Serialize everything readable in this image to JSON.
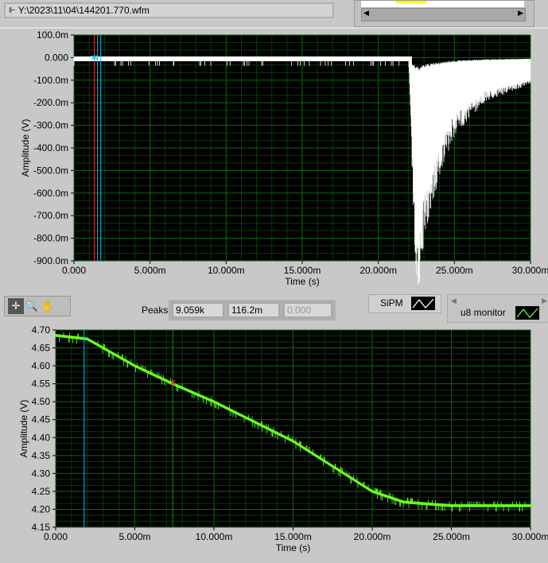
{
  "file_path": {
    "icon": "path-icon",
    "value": "Y:\\2023\\11\\04\\144201.770.wfm"
  },
  "toolbar": {
    "tools": [
      "cursor-move-icon",
      "zoom-icon",
      "pan-hand-icon"
    ]
  },
  "peaks": {
    "label": "Peaks",
    "values": [
      "9.059k",
      "116.2m",
      "0.000"
    ]
  },
  "legend": {
    "sipm": "SiPM",
    "u8": "u8 monitor"
  },
  "colors": {
    "plot_bg": "#000000",
    "grid": "#0b6b0b",
    "sipm": "#ffffff",
    "u8": "#66ff22",
    "cursor1": "#00c0ff",
    "cursor2": "#ff3030"
  },
  "chart_data": [
    {
      "type": "line",
      "name": "SiPM",
      "xlabel": "Time (s)",
      "ylabel": "Amplitude (V)",
      "xlim": [
        0,
        0.03
      ],
      "ylim": [
        -0.9,
        0.1
      ],
      "grid": true,
      "xticks": [
        "0.000",
        "5.000m",
        "10.000m",
        "15.000m",
        "20.000m",
        "25.000m",
        "30.000m"
      ],
      "yticks": [
        "100.0m",
        "0.000",
        "-100.0m",
        "-200.0m",
        "-300.0m",
        "-400.0m",
        "-500.0m",
        "-600.0m",
        "-700.0m",
        "-800.0m",
        "-900.0m"
      ],
      "x": [
        0,
        0.005,
        0.01,
        0.015,
        0.02,
        0.022,
        0.0223,
        0.0226,
        0.023,
        0.024,
        0.025,
        0.027,
        0.03
      ],
      "y": [
        -0.01,
        -0.01,
        -0.01,
        -0.01,
        -0.01,
        -0.01,
        -0.55,
        -0.86,
        -0.62,
        -0.4,
        -0.25,
        -0.15,
        -0.1
      ],
      "cursor_x": 0.00155
    },
    {
      "type": "line",
      "name": "u8 monitor",
      "xlabel": "Time (s)",
      "ylabel": "Amplitude (V)",
      "xlim": [
        0,
        0.03
      ],
      "ylim": [
        4.15,
        4.7
      ],
      "grid": true,
      "xticks": [
        "0.000",
        "5.000m",
        "10.000m",
        "15.000m",
        "20.000m",
        "25.000m",
        "30.000m"
      ],
      "yticks": [
        "4.70",
        "4.65",
        "4.60",
        "4.55",
        "4.50",
        "4.45",
        "4.40",
        "4.35",
        "4.30",
        "4.25",
        "4.20",
        "4.15"
      ],
      "x": [
        0,
        0.002,
        0.005,
        0.0074,
        0.01,
        0.015,
        0.02,
        0.022,
        0.025,
        0.03
      ],
      "y": [
        4.685,
        4.675,
        4.6,
        4.55,
        4.5,
        4.39,
        4.25,
        4.22,
        4.21,
        4.21
      ],
      "cursor_x": 0.0018,
      "marker_x": 0.0074
    }
  ]
}
